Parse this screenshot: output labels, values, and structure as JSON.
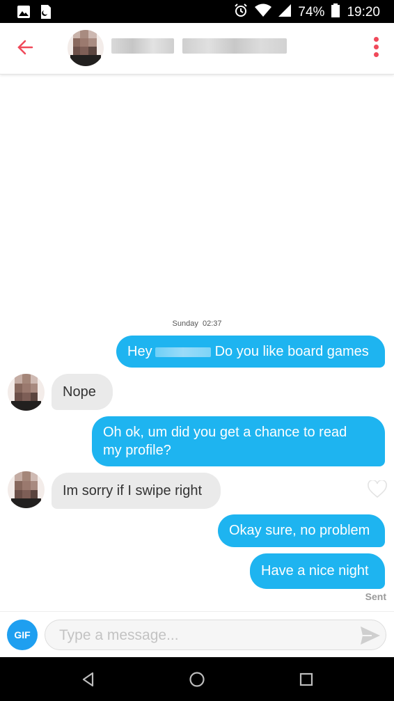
{
  "status_bar": {
    "battery": "74%",
    "time": "19:20",
    "icons": [
      "gallery-icon",
      "sim-icon",
      "alarm-icon",
      "wifi-icon",
      "signal-icon",
      "battery-icon"
    ]
  },
  "header": {
    "back_icon": "arrow-left-icon",
    "menu_icon": "kebab-menu-icon",
    "accent_color": "#f0495a"
  },
  "chat": {
    "timestamp_day": "Sunday",
    "timestamp_time": "02:37",
    "messages": [
      {
        "direction": "outgoing",
        "text_before": "Hey",
        "text_after": "Do you like board games"
      },
      {
        "direction": "incoming",
        "text": "Nope"
      },
      {
        "direction": "outgoing",
        "line1": "Oh ok, um did you get a chance to read",
        "line2": "my profile?"
      },
      {
        "direction": "incoming",
        "text": "Im sorry if I swipe right"
      },
      {
        "direction": "outgoing",
        "text": "Okay sure, no problem"
      },
      {
        "direction": "outgoing",
        "text": "Have a nice night"
      }
    ],
    "sent_label": "Sent",
    "outgoing_color": "#1eb4f0",
    "incoming_color": "#eaeaea"
  },
  "composer": {
    "gif_label": "GIF",
    "placeholder": "Type a message...",
    "value": ""
  },
  "nav_bar": {
    "icons": [
      "back-triangle-icon",
      "home-circle-icon",
      "recents-square-icon"
    ]
  }
}
